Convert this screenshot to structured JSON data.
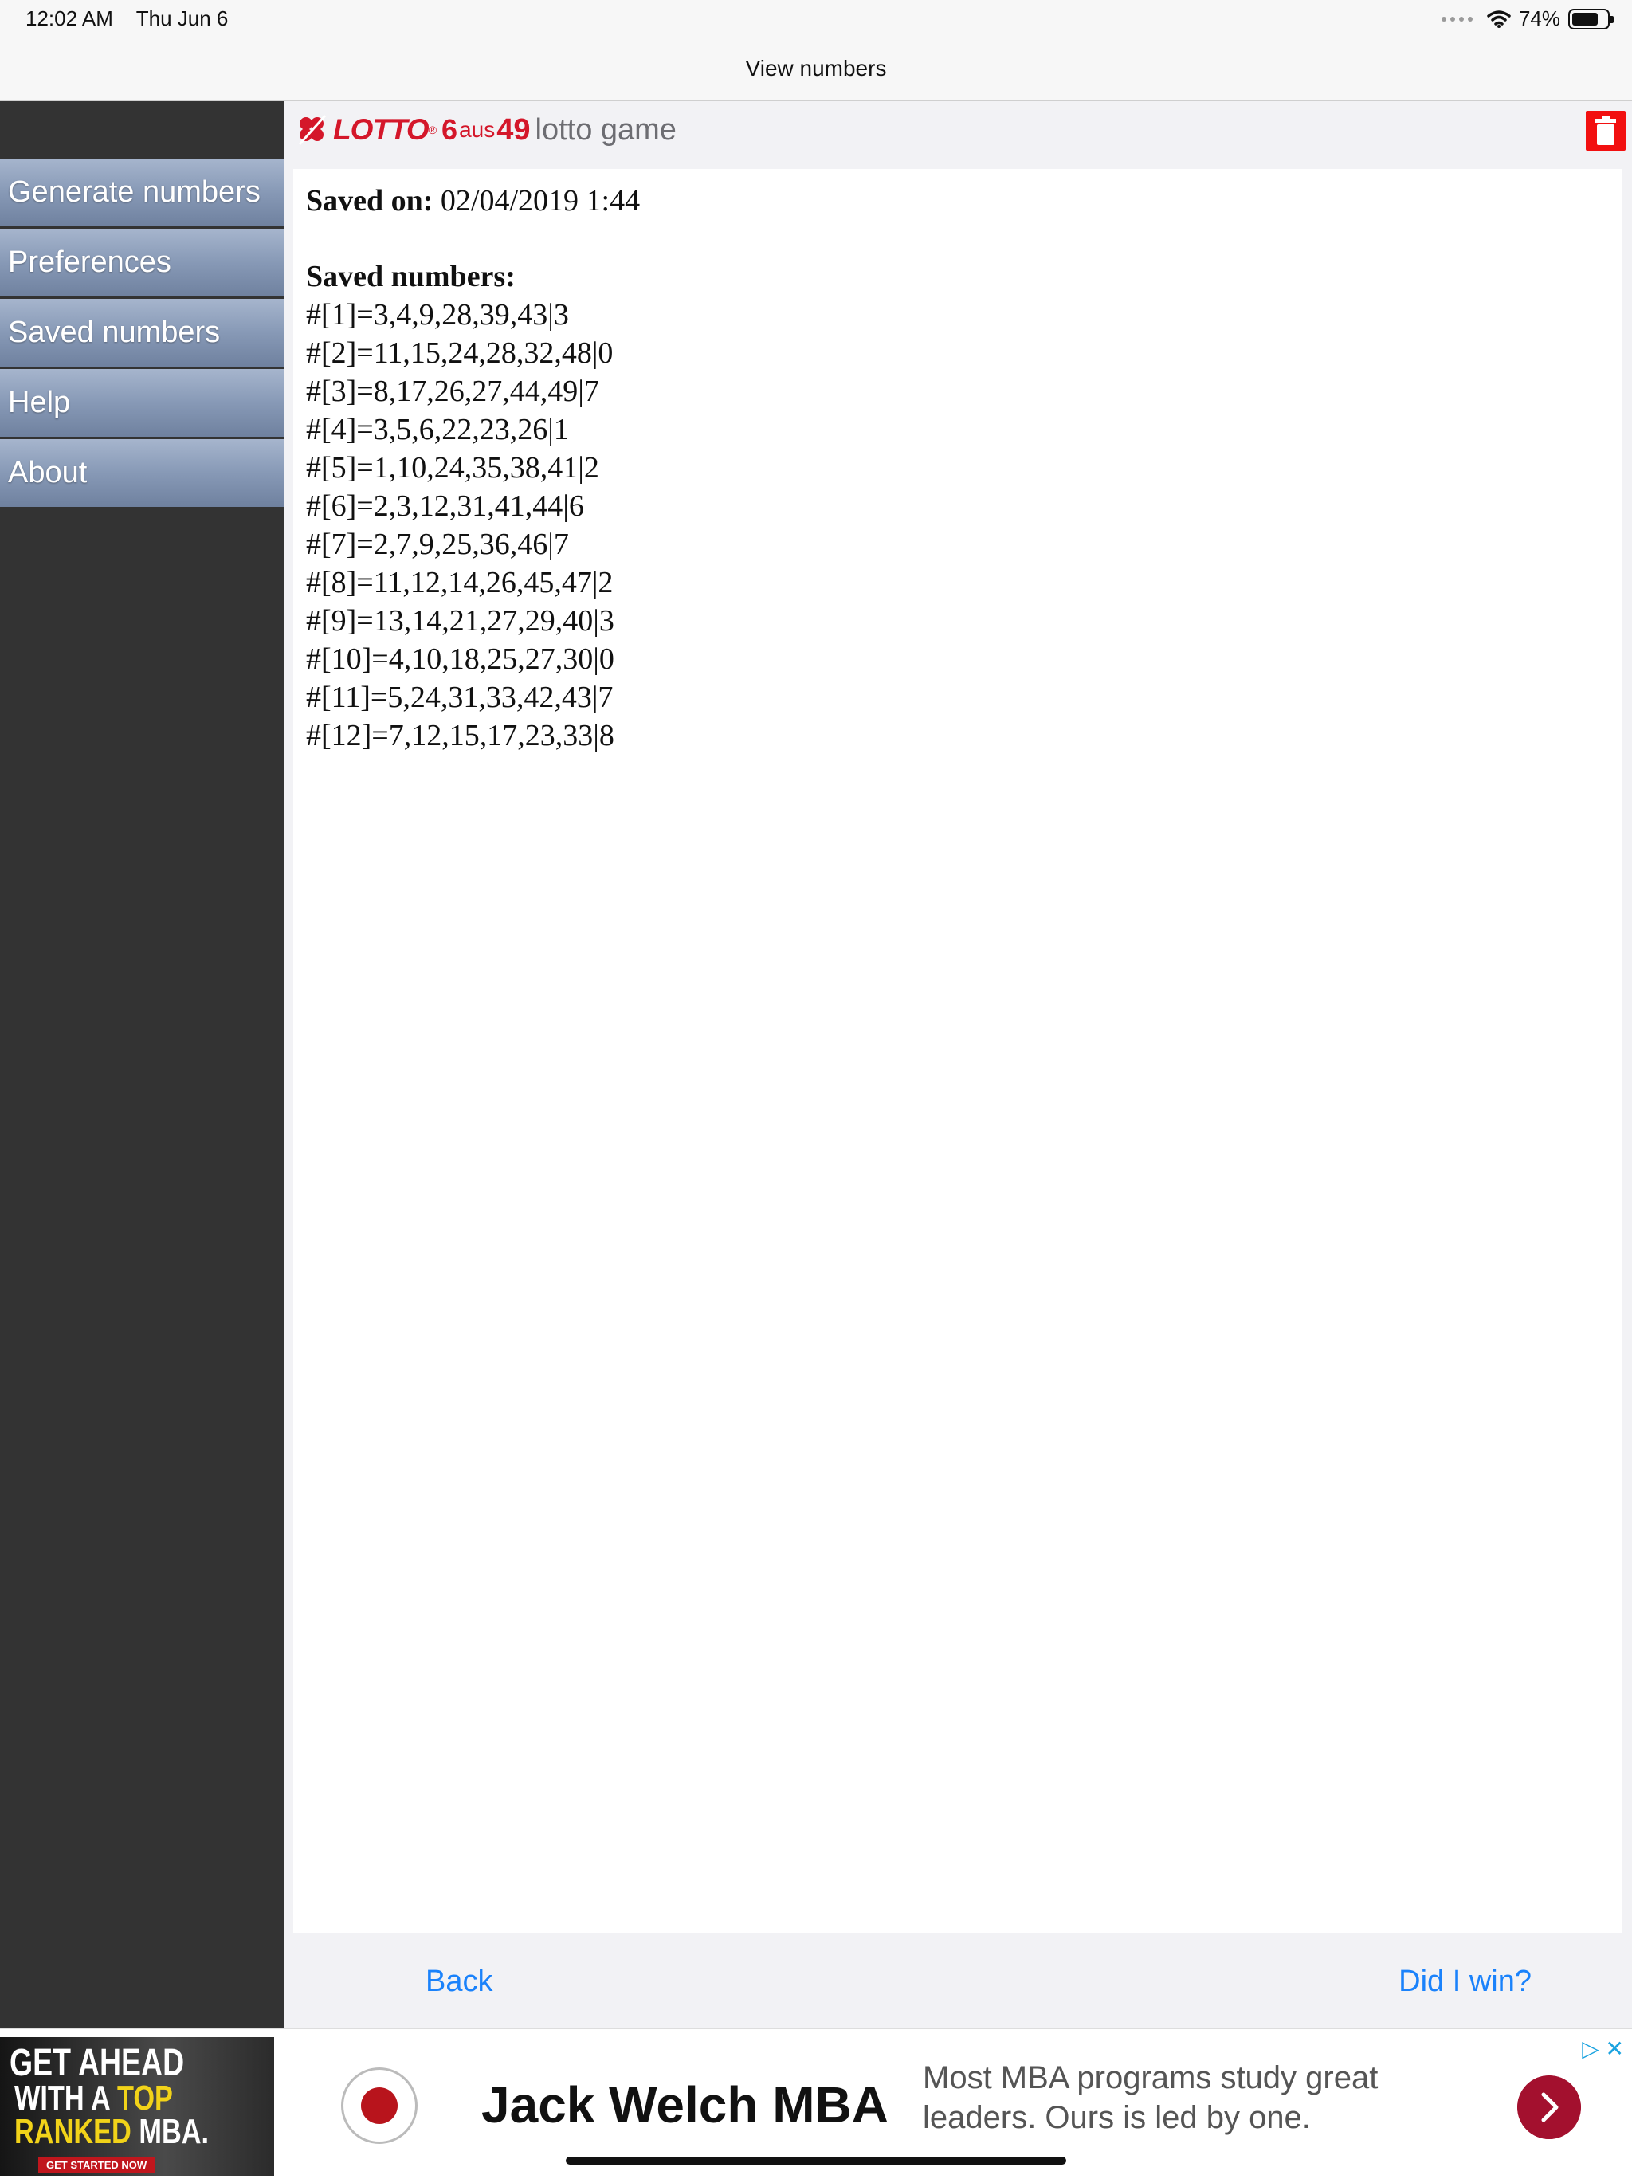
{
  "status_bar": {
    "time": "12:02 AM",
    "date": "Thu Jun 6",
    "battery": "74%",
    "battery_level": 0.74,
    "icons": [
      "signal-dots-icon",
      "wifi-icon",
      "battery-icon"
    ]
  },
  "nav": {
    "title": "View numbers"
  },
  "sidebar": {
    "items": [
      {
        "label": "Generate numbers"
      },
      {
        "label": "Preferences"
      },
      {
        "label": "Saved numbers"
      },
      {
        "label": "Help"
      },
      {
        "label": "About"
      }
    ]
  },
  "brand": {
    "lotto": "LOTTO",
    "reg": "®",
    "six": "6",
    "aus": "aus",
    "fortynine": "49",
    "suffix": "lotto game",
    "accent": "#d4172a"
  },
  "content": {
    "saved_on_label": "Saved on:",
    "saved_on_value": "02/04/2019 1:44",
    "saved_numbers_label": "Saved numbers:",
    "numbers": [
      "#[1]=3,4,9,28,39,43|3",
      "#[2]=11,15,24,28,32,48|0",
      "#[3]=8,17,26,27,44,49|7",
      "#[4]=3,5,6,22,23,26|1",
      "#[5]=1,10,24,35,38,41|2",
      "#[6]=2,3,12,31,41,44|6",
      "#[7]=2,7,9,25,36,46|7",
      "#[8]=11,12,14,26,45,47|2",
      "#[9]=13,14,21,27,29,40|3",
      "#[10]=4,10,18,25,27,30|0",
      "#[11]=5,24,31,33,42,43|7",
      "#[12]=7,12,15,17,23,33|8"
    ],
    "trash_icon": "trash-icon"
  },
  "actions": {
    "back": "Back",
    "did_i_win": "Did I win?",
    "link_color": "#1a82fb"
  },
  "ad": {
    "image_line1": "GET AHEAD",
    "image_line2_a": "WITH A ",
    "image_line2_b": "TOP",
    "image_line3_a": "RANKED ",
    "image_line3_b": "MBA.",
    "image_cta": "GET STARTED NOW",
    "title": "Jack Welch MBA",
    "description": "Most MBA programs study great leaders. Ours is led by one."
  },
  "colors": {
    "sidebar_bg": "#333333",
    "delete_red": "#f21010",
    "ad_button": "#a3102e"
  }
}
